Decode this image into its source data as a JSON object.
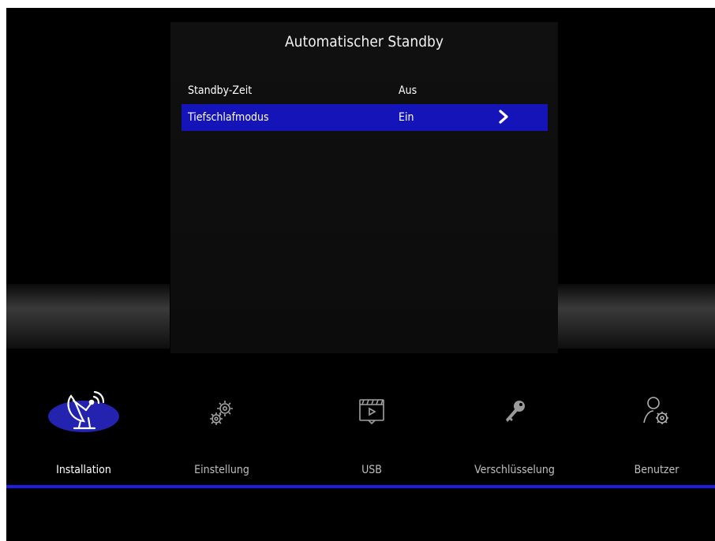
{
  "menu": {
    "title": "Automatischer Standby",
    "items": [
      {
        "label": "Standby-Zeit",
        "value": "Aus",
        "selected": false
      },
      {
        "label": "Tiefschlafmodus",
        "value": "Ein",
        "selected": true
      }
    ],
    "highlight_color": "#1414b8"
  },
  "nav": {
    "items": [
      {
        "label": "Installation",
        "icon": "satellite-dish-icon",
        "active": true
      },
      {
        "label": "Einstellung",
        "icon": "gears-icon",
        "active": false
      },
      {
        "label": "USB",
        "icon": "media-clapper-icon",
        "active": false
      },
      {
        "label": "Verschlüsselung",
        "icon": "key-icon",
        "active": false
      },
      {
        "label": "Benutzer",
        "icon": "user-settings-icon",
        "active": false
      }
    ],
    "accent_color": "#1e1ee0"
  }
}
